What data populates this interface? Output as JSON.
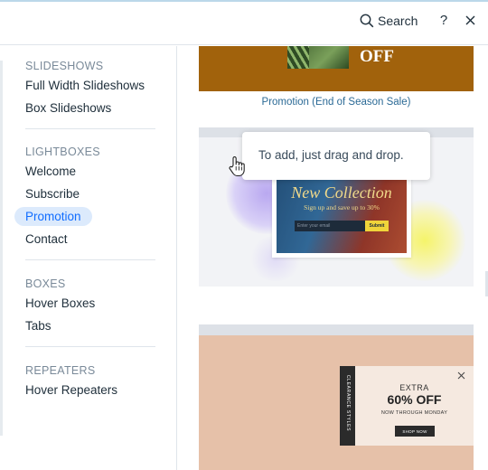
{
  "topbar": {
    "search_label": "Search",
    "help_label": "?",
    "icons": {
      "search": "search-icon",
      "close": "close-icon"
    }
  },
  "sidebar": {
    "sections": [
      {
        "title": "SLIDESHOWS",
        "items": [
          "Full Width Slideshows",
          "Box Slideshows"
        ]
      },
      {
        "title": "LIGHTBOXES",
        "items": [
          "Welcome",
          "Subscribe",
          "Promotion",
          "Contact"
        ]
      },
      {
        "title": "BOXES",
        "items": [
          "Hover Boxes",
          "Tabs"
        ]
      },
      {
        "title": "REPEATERS",
        "items": [
          "Hover Repeaters"
        ]
      }
    ],
    "active_item": "Promotion"
  },
  "main": {
    "card1": {
      "text": "OFF",
      "caption": "Promotion (End of Season Sale)"
    },
    "card2": {
      "title": "New Collection",
      "subtitle": "Sign up and save up to 30%",
      "email_placeholder": "Enter your email",
      "submit_label": "Submit"
    },
    "tooltip": "To add, just drag and drop.",
    "card3": {
      "side_label": "CLEARANCE STYLES",
      "extra": "EXTRA",
      "offer": "60% OFF",
      "through": "NOW THROUGH MONDAY",
      "shop": "SHOP NOW"
    }
  },
  "colors": {
    "accent": "#116dff",
    "active_bg": "#dceafc",
    "card1_bg": "#a1620c",
    "card3_bg": "#e6c1a9",
    "caption": "#2b6a96"
  }
}
